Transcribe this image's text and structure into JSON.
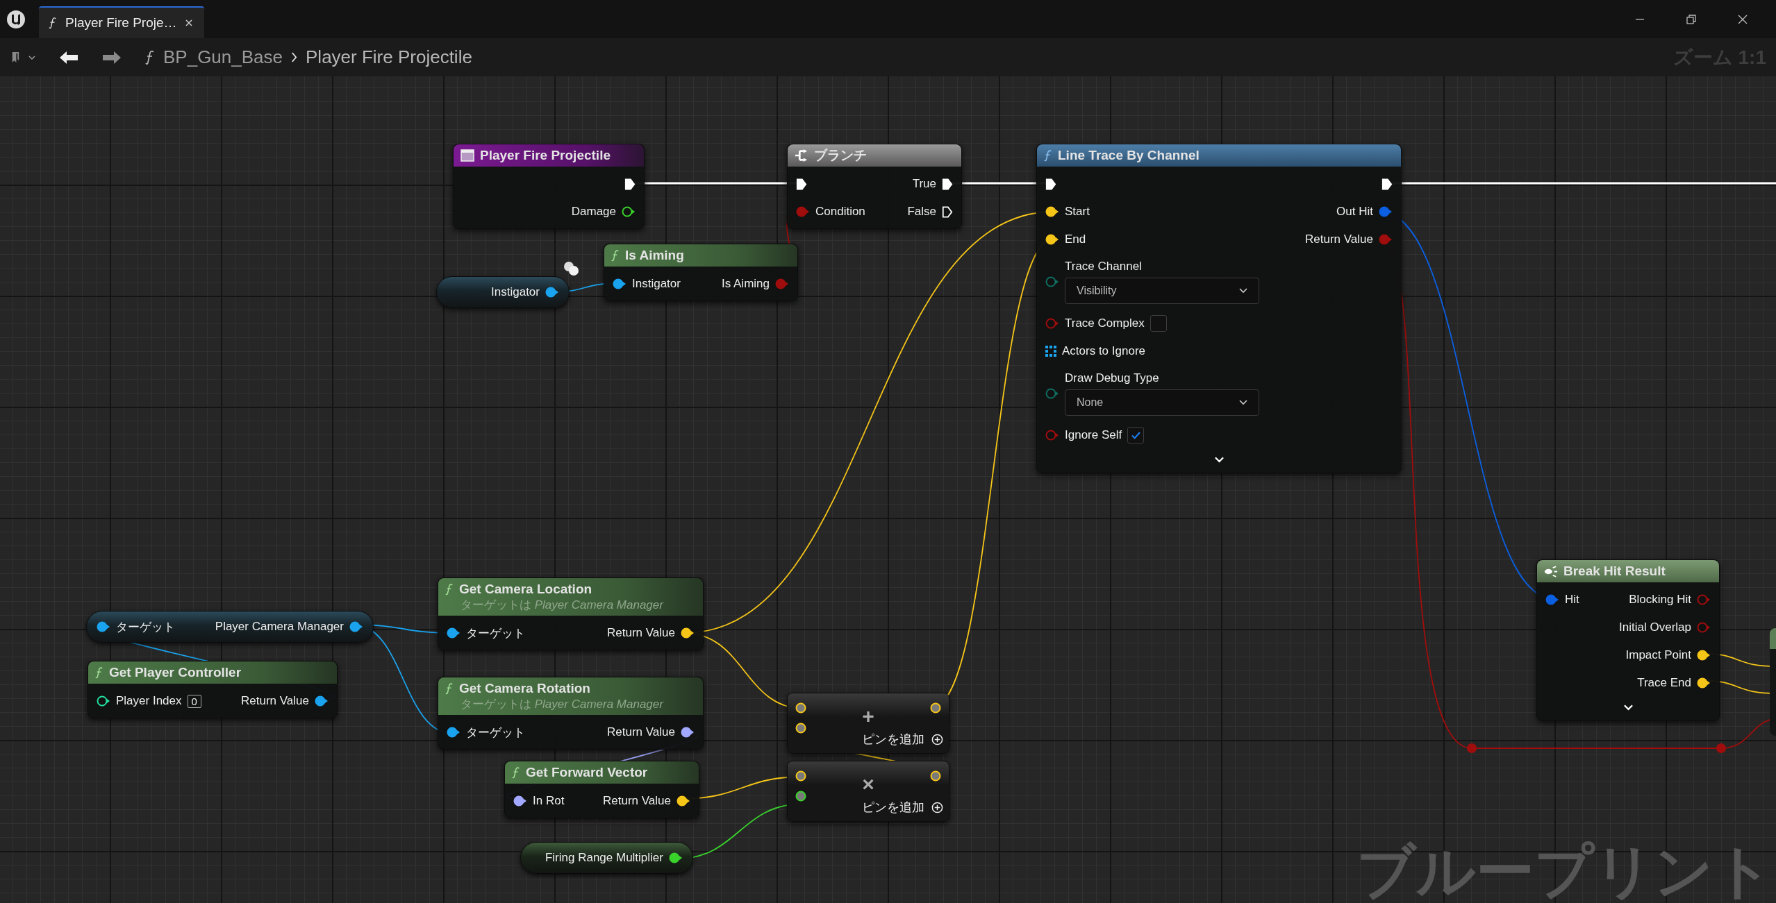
{
  "tab": {
    "title": "Player Fire Proje…"
  },
  "breadcrumb": {
    "items": [
      "BP_Gun_Base",
      "Player Fire Projectile"
    ]
  },
  "zoom_label": "ズーム 1:1",
  "watermark": "ブループリント",
  "nodes": [
    {
      "kind": "event",
      "title": "Player Fire Projectile",
      "rows": [
        {
          "kind": "pins",
          "right": {
            "kind": "exec",
            "linked": true
          }
        },
        {
          "kind": "pins",
          "right": {
            "label": "Damage",
            "kind": "float",
            "linked": false
          }
        }
      ]
    },
    {
      "kind": "branch",
      "title": "ブランチ",
      "rows": [
        {
          "kind": "pins",
          "left": {
            "kind": "exec",
            "linked": true
          },
          "right": {
            "label": "True",
            "kind": "exec",
            "linked": true
          }
        },
        {
          "kind": "pins",
          "left": {
            "label": "Condition",
            "kind": "bool",
            "linked": true
          },
          "right": {
            "label": "False",
            "kind": "exec",
            "linked": false
          }
        }
      ]
    },
    {
      "kind": "function",
      "title": "Line Trace By Channel",
      "expandable": true,
      "rows": [
        {
          "kind": "pins",
          "left": {
            "kind": "exec",
            "linked": true
          },
          "right": {
            "kind": "exec",
            "linked": true
          }
        },
        {
          "kind": "pins",
          "left": {
            "label": "Start",
            "kind": "vector",
            "linked": true
          },
          "right": {
            "label": "Out Hit",
            "kind": "struct",
            "linked": true
          }
        },
        {
          "kind": "pins",
          "left": {
            "label": "End",
            "kind": "vector",
            "linked": true
          },
          "right": {
            "label": "Return Value",
            "kind": "bool",
            "linked": true
          }
        },
        {
          "kind": "dropdown",
          "label": "Trace Channel",
          "value": "Visibility",
          "pin": {
            "kind": "byte",
            "linked": false
          }
        },
        {
          "kind": "checkbox",
          "label": "Trace Complex",
          "checked": false,
          "pin": {
            "kind": "bool",
            "linked": false
          }
        },
        {
          "kind": "array",
          "label": "Actors to Ignore"
        },
        {
          "kind": "dropdown",
          "label": "Draw Debug Type",
          "value": "None",
          "pin": {
            "kind": "byte",
            "linked": false
          }
        },
        {
          "kind": "checkbox",
          "label": "Ignore Self",
          "checked": true,
          "pin": {
            "kind": "bool",
            "linked": false
          }
        }
      ]
    },
    {
      "kind": "pure",
      "title": "Is Aiming",
      "rows": [
        {
          "kind": "pins",
          "left": {
            "label": "Instigator",
            "kind": "object",
            "linked": true
          },
          "right": {
            "label": "Is Aiming",
            "kind": "bool",
            "linked": true
          }
        }
      ]
    },
    {
      "kind": "variable",
      "rows": [
        {
          "kind": "pins",
          "right": {
            "label": "Instigator",
            "kind": "object",
            "linked": true
          }
        }
      ]
    },
    {
      "kind": "pure",
      "title": "Get Camera Location",
      "subtitle": "ターゲットは *Player Camera Manager*",
      "rows": [
        {
          "kind": "pins",
          "left": {
            "label": "ターゲット",
            "kind": "object",
            "linked": true
          },
          "right": {
            "label": "Return Value",
            "kind": "vector",
            "linked": true
          }
        }
      ]
    },
    {
      "kind": "pure",
      "title": "Get Camera Rotation",
      "subtitle": "ターゲットは *Player Camera Manager*",
      "rows": [
        {
          "kind": "pins",
          "left": {
            "label": "ターゲット",
            "kind": "object",
            "linked": true
          },
          "right": {
            "label": "Return Value",
            "kind": "rotator",
            "linked": true
          }
        }
      ]
    },
    {
      "kind": "variable",
      "rows": [
        {
          "kind": "pins",
          "left": {
            "label": "ターゲット",
            "kind": "object",
            "linked": true
          },
          "right": {
            "label": "Player Camera Manager",
            "kind": "object",
            "linked": true
          }
        }
      ]
    },
    {
      "kind": "pure",
      "title": "Get Player Controller",
      "rows": [
        {
          "kind": "pins",
          "left": {
            "label": "Player Index",
            "kind": "int",
            "linked": false,
            "value": "0"
          },
          "right": {
            "label": "Return Value",
            "kind": "object",
            "linked": true
          }
        }
      ]
    },
    {
      "kind": "pure",
      "title": "Get Forward Vector",
      "rows": [
        {
          "kind": "pins",
          "left": {
            "label": "In Rot",
            "kind": "rotator",
            "linked": true
          },
          "right": {
            "label": "Return Value",
            "kind": "vector",
            "linked": true
          }
        }
      ]
    },
    {
      "kind": "math",
      "symbol": "+",
      "add_pin": "ピンを追加",
      "rows": [
        {
          "kind": "pins",
          "left": {
            "kind": "vector",
            "linked": true
          },
          "right": {
            "kind": "vector",
            "linked": true
          }
        },
        {
          "kind": "pins",
          "left": {
            "kind": "vector",
            "linked": true
          }
        }
      ]
    },
    {
      "kind": "math",
      "symbol": "×",
      "add_pin": "ピンを追加",
      "rows": [
        {
          "kind": "pins",
          "left": {
            "kind": "vector",
            "linked": true
          },
          "right": {
            "kind": "vector",
            "linked": true
          }
        },
        {
          "kind": "pins",
          "left": {
            "kind": "float",
            "linked": true
          }
        }
      ]
    },
    {
      "kind": "variable",
      "rows": [
        {
          "kind": "pins",
          "right": {
            "label": "Firing Range Multiplier",
            "kind": "float",
            "linked": true
          }
        }
      ]
    },
    {
      "kind": "struct",
      "title": "Break Hit Result",
      "expandable": true,
      "rows": [
        {
          "kind": "pins",
          "left": {
            "label": "Hit",
            "kind": "struct",
            "linked": true
          },
          "right": {
            "label": "Blocking Hit",
            "kind": "bool",
            "linked": false
          }
        },
        {
          "kind": "pins",
          "right": {
            "label": "Initial Overlap",
            "kind": "bool",
            "linked": false
          }
        },
        {
          "kind": "pins",
          "right": {
            "label": "Impact Point",
            "kind": "vector",
            "linked": true
          }
        },
        {
          "kind": "pins",
          "right": {
            "label": "Trace End",
            "kind": "vector",
            "linked": true
          }
        }
      ]
    }
  ]
}
